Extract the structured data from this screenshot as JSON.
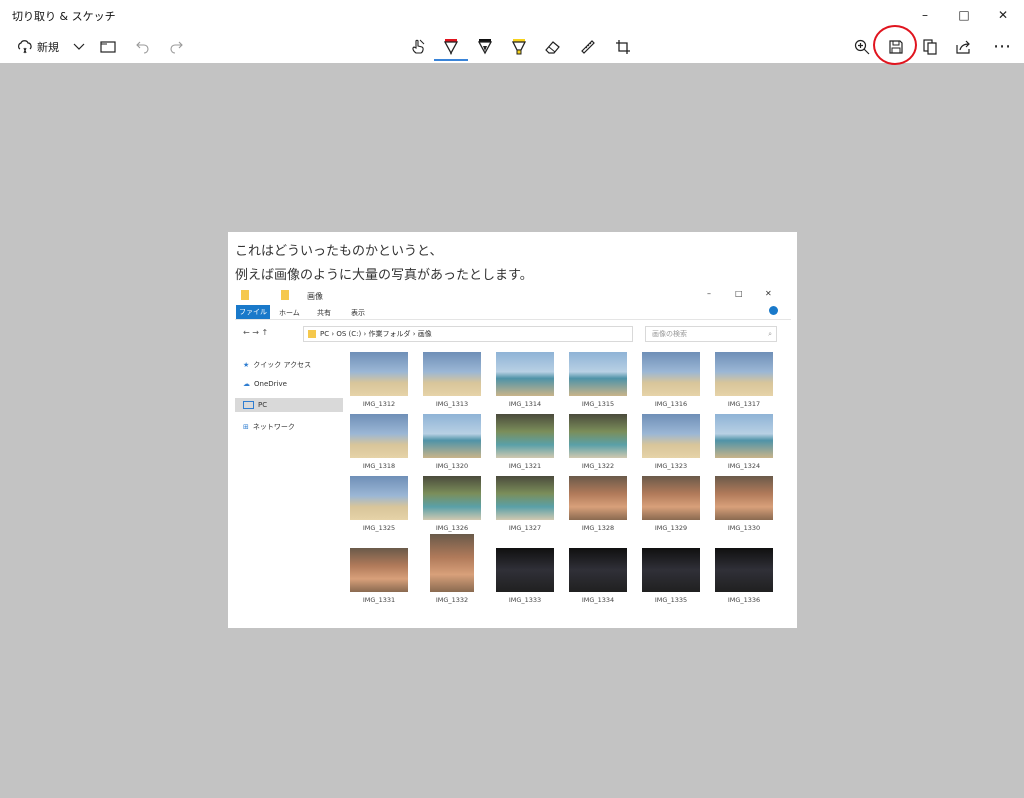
{
  "window": {
    "title": "切り取り & スケッチ",
    "controls": {
      "minimize": "–",
      "maximize": "□",
      "close": "✕"
    }
  },
  "toolbar": {
    "new_label": "新規",
    "icons": [
      "new-snip-icon",
      "chevron-down-icon",
      "folder-icon",
      "undo-icon",
      "redo-icon",
      "touch-writing-icon",
      "ballpoint-pen-icon",
      "pencil-icon",
      "highlighter-icon",
      "eraser-icon",
      "ruler-icon",
      "crop-icon",
      "zoom-icon",
      "save-icon",
      "copy-icon",
      "share-icon",
      "more-icon"
    ],
    "more_label": "⋯",
    "accent": "#3a84d8",
    "annotation_color": "#e0141e"
  },
  "snip": {
    "line1": "これはどういったものかというと、",
    "line2": "例えば画像のように大量の写真があったとします。",
    "explorer": {
      "path_label": "画像",
      "ribbon": [
        "ファイル",
        "ホーム",
        "共有",
        "表示"
      ],
      "address": [
        "PC",
        "OS (C:)",
        "作業フォルダ",
        "画像"
      ],
      "search_placeholder": "画像の検索",
      "nav": [
        {
          "label": "クイック アクセス",
          "icon": "star-icon"
        },
        {
          "label": "OneDrive",
          "icon": "cloud-icon"
        },
        {
          "label": "PC",
          "icon": "pc-icon"
        },
        {
          "label": "ネットワーク",
          "icon": "network-icon"
        }
      ],
      "files": [
        "IMG_1312",
        "IMG_1313",
        "IMG_1314",
        "IMG_1315",
        "IMG_1316",
        "IMG_1317",
        "IMG_1318",
        "IMG_1320",
        "IMG_1321",
        "IMG_1322",
        "IMG_1323",
        "IMG_1324",
        "IMG_1325",
        "IMG_1326",
        "IMG_1327",
        "IMG_1328",
        "IMG_1329",
        "IMG_1330",
        "IMG_1331",
        "IMG_1332",
        "IMG_1333",
        "IMG_1334",
        "IMG_1335",
        "IMG_1336"
      ]
    }
  }
}
